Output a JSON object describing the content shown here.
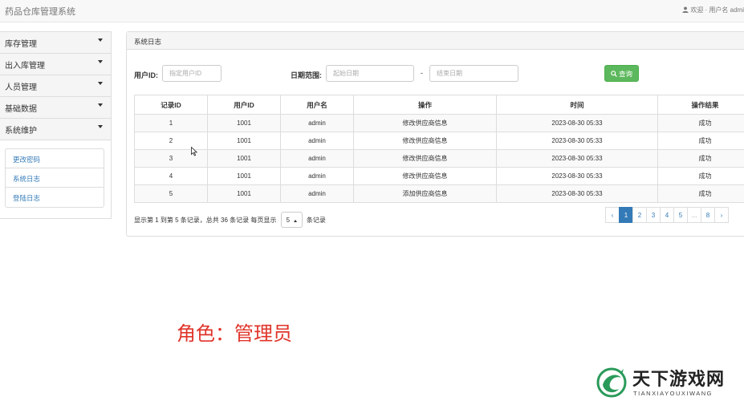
{
  "header": {
    "brand": "药品仓库管理系统",
    "user_text": "欢迎 · 用户名 admi",
    "user_icon": "user-icon"
  },
  "sidebar": {
    "items": [
      {
        "label": "库存管理",
        "icon": "caret-down-icon"
      },
      {
        "label": "出入库管理",
        "icon": "caret-down-icon"
      },
      {
        "label": "人员管理",
        "icon": "caret-down-icon"
      },
      {
        "label": "基础数据",
        "icon": "caret-down-icon"
      },
      {
        "label": "系统维护",
        "icon": "caret-down-icon"
      }
    ],
    "submenu": [
      {
        "label": "更改密码"
      },
      {
        "label": "系统日志"
      },
      {
        "label": "登陆日志"
      }
    ]
  },
  "panel": {
    "title": "系统日志"
  },
  "filters": {
    "user_id_label": "用户ID:",
    "user_id_placeholder": "指定用户ID",
    "date_range_label": "日期范围:",
    "start_date_placeholder": "起始日期",
    "separator": "-",
    "end_date_placeholder": "结束日期",
    "query_label": "查询",
    "query_icon": "search-icon",
    "query_color": "#5cb85c"
  },
  "table": {
    "columns": [
      "记录ID",
      "用户ID",
      "用户名",
      "操作",
      "时间",
      "操作结果"
    ],
    "rows": [
      [
        "1",
        "1001",
        "admin",
        "修改供应商信息",
        "2023-08-30 05:33",
        "成功"
      ],
      [
        "2",
        "1001",
        "admin",
        "修改供应商信息",
        "2023-08-30 05:33",
        "成功"
      ],
      [
        "3",
        "1001",
        "admin",
        "修改供应商信息",
        "2023-08-30 05:33",
        "成功"
      ],
      [
        "4",
        "1001",
        "admin",
        "修改供应商信息",
        "2023-08-30 05:33",
        "成功"
      ],
      [
        "5",
        "1001",
        "admin",
        "添加供应商信息",
        "2023-08-30 05:33",
        "成功"
      ]
    ]
  },
  "pager": {
    "info_prefix": "显示第 1 到第 5 条记录，总共 36 条记录 每页显示",
    "page_size": "5",
    "info_suffix": "条记录",
    "prev": "‹",
    "pages": [
      "1",
      "2",
      "3",
      "4",
      "5",
      "...",
      "8"
    ],
    "next": "›",
    "active_page": "1",
    "accent": "#337ab7"
  },
  "caption": {
    "text": "角色：管理员",
    "color": "#e0342a"
  },
  "watermark": {
    "title": "天下游戏网",
    "subtitle": "TIANXIAYOUXIWANG"
  }
}
